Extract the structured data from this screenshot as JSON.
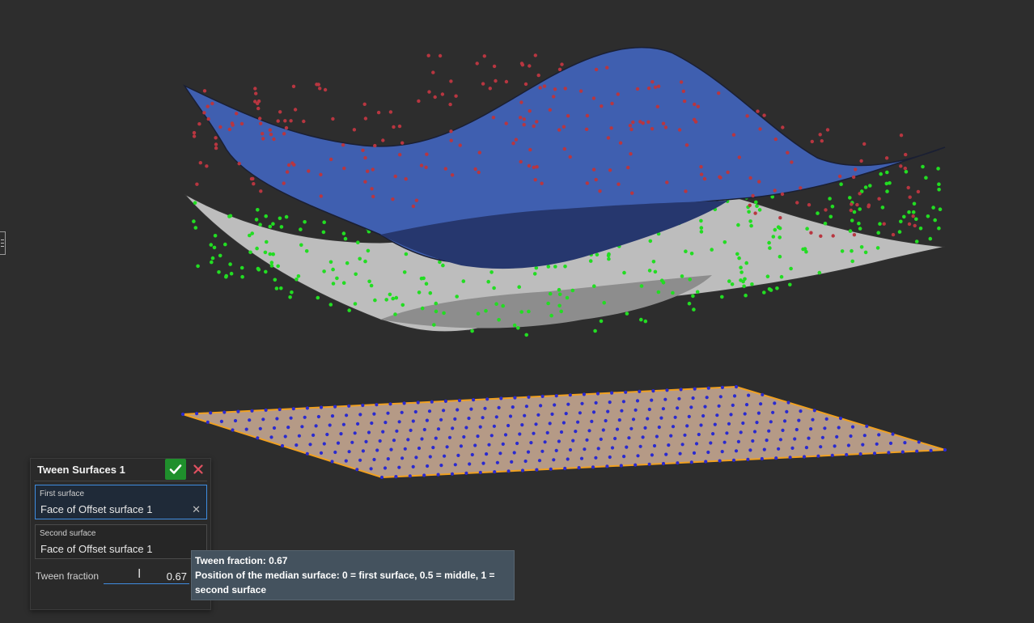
{
  "dialog": {
    "title": "Tween Surfaces 1",
    "confirm_icon": "check-icon",
    "cancel_icon": "close-icon",
    "first_surface": {
      "label": "First surface",
      "value": "Face of Offset surface 1"
    },
    "second_surface": {
      "label": "Second surface",
      "value": "Face of Offset surface 1"
    },
    "tween_fraction": {
      "label": "Tween fraction",
      "value": "0.67"
    }
  },
  "tooltip": {
    "title": "Tween fraction: 0.67",
    "description": "Position of the median surface: 0 = first surface, 0.5 = middle, 1 = second surface"
  },
  "colors": {
    "background": "#2d2d2d",
    "first_surface_fill": "#3f5fb0",
    "first_surface_points": "#b83640",
    "tween_surface_fill": "#bdbdbd",
    "tween_surface_points": "#22dd22",
    "second_surface_fill": "#b59a86",
    "second_surface_edge": "#f0a020",
    "second_surface_points": "#2a2ad0",
    "confirm": "#1f8f2c",
    "cancel": "#e05060",
    "accent": "#3f8de0"
  }
}
